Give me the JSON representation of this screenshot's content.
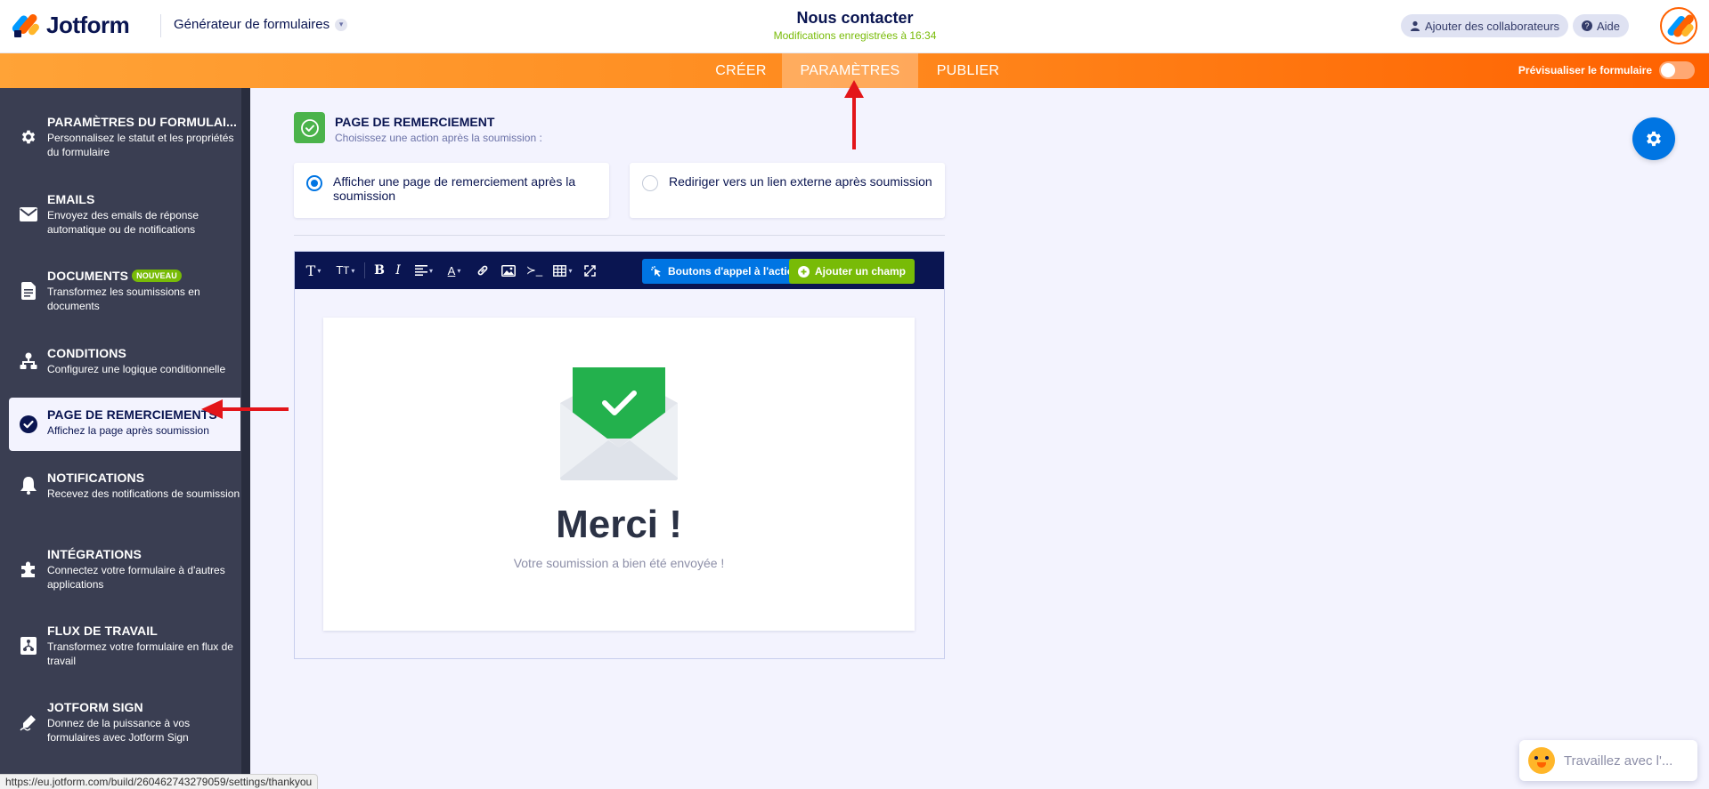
{
  "header": {
    "brand": "Jotform",
    "builder_label": "Générateur de formulaires",
    "form_title": "Nous contacter",
    "save_status": "Modifications enregistrées à 16:34",
    "collaborators_label": "Ajouter des collaborateurs",
    "help_label": "Aide"
  },
  "nav": {
    "tabs": [
      {
        "label": "CRÉER"
      },
      {
        "label": "PARAMÈTRES"
      },
      {
        "label": "PUBLIER"
      }
    ],
    "preview_label": "Prévisualiser le formulaire"
  },
  "sidebar": {
    "items": [
      {
        "title": "PARAMÈTRES DU FORMULAI...",
        "desc": "Personnalisez le statut et les propriétés du formulaire",
        "icon": "gear-icon"
      },
      {
        "title": "EMAILS",
        "desc": "Envoyez des emails de réponse automatique ou de notifications",
        "icon": "envelope-icon"
      },
      {
        "title": "DOCUMENTS",
        "badge": "NOUVEAU",
        "desc": "Transformez les soumissions en documents",
        "icon": "document-icon"
      },
      {
        "title": "CONDITIONS",
        "desc": "Configurez une logique conditionnelle",
        "icon": "flowchart-icon"
      },
      {
        "title": "PAGE DE REMERCIEMENTS",
        "desc": "Affichez la page après soumission",
        "icon": "check-circle-icon"
      },
      {
        "title": "NOTIFICATIONS",
        "desc": "Recevez des notifications de soumission",
        "icon": "bell-icon"
      },
      {
        "title": "INTÉGRATIONS",
        "desc": "Connectez votre formulaire à d'autres applications",
        "icon": "puzzle-icon"
      },
      {
        "title": "FLUX DE TRAVAIL",
        "desc": "Transformez votre formulaire en flux de travail",
        "icon": "workflow-icon"
      },
      {
        "title": "JOTFORM SIGN",
        "desc": "Donnez de la puissance à vos formulaires avec Jotform Sign",
        "icon": "pen-icon"
      }
    ]
  },
  "main": {
    "section_title": "PAGE DE REMERCIEMENT",
    "section_sub": "Choisissez une action après la soumission :",
    "option_thankyou": "Afficher une page de remerciement après la soumission",
    "option_redirect": "Rediriger vers un lien externe après soumission",
    "cta_label": "Boutons d'appel à l'action",
    "add_field_label": "Ajouter un champ",
    "merci": "Merci !",
    "merci_sub": "Votre soumission a bien été envoyée !"
  },
  "assistant": {
    "label": "Travaillez avec l'..."
  },
  "status_url": "https://eu.jotform.com/build/260462743279059/settings/thankyou",
  "colors": {
    "orange": "#ff6100",
    "navy": "#0a1551",
    "blue": "#0075e3",
    "green": "#78bb07",
    "sidebar": "#3a3e52"
  }
}
